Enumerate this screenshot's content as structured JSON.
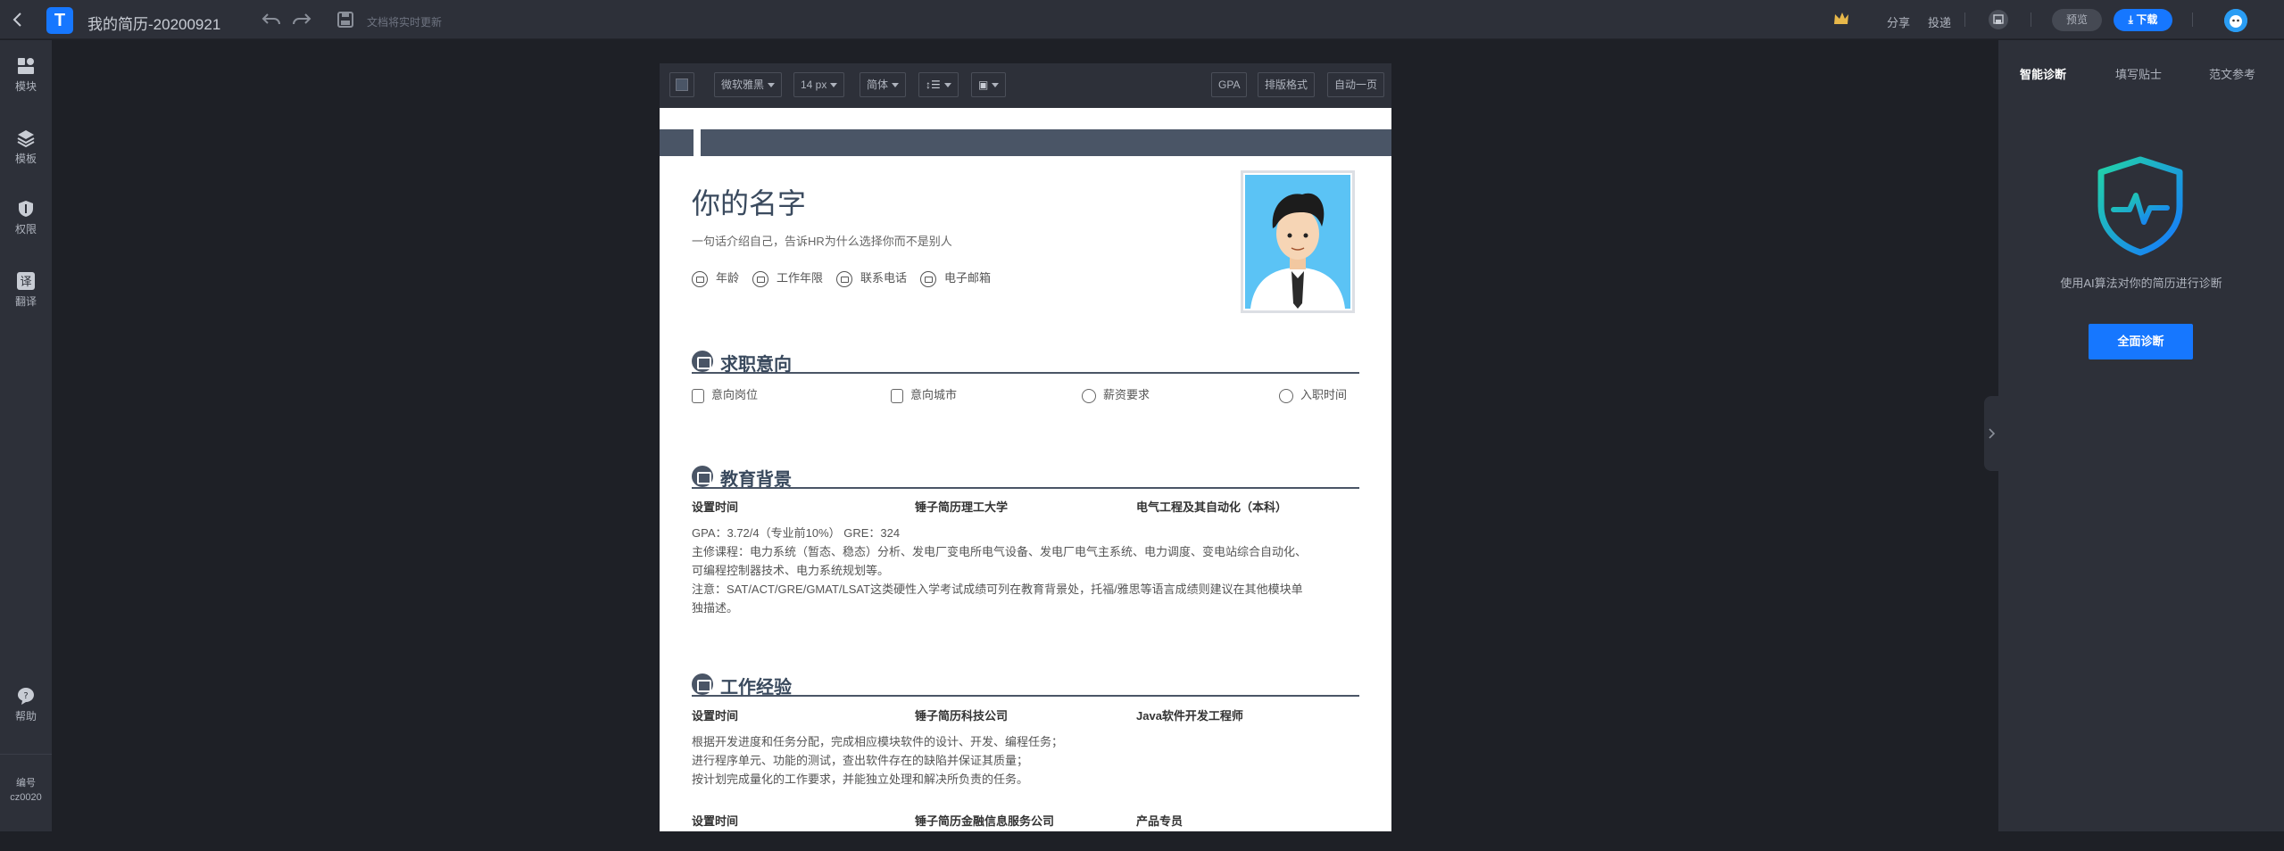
{
  "topbar": {
    "doc_title": "我的简历-20200921",
    "save_status": "文档将实时更新",
    "share": "分享",
    "deliver": "投递",
    "preview": "预览",
    "download": "下载",
    "logo_glyph": "T"
  },
  "leftbar": {
    "items": [
      {
        "label": "模块",
        "icon": "module-icon"
      },
      {
        "label": "模板",
        "icon": "template-icon"
      },
      {
        "label": "权限",
        "icon": "permission-icon"
      },
      {
        "label": "翻译",
        "icon": "translate-icon"
      }
    ],
    "help": "帮助",
    "code_label": "编号",
    "code_value": "cz0020"
  },
  "toolbar": {
    "font": "微软雅黑",
    "size": "14 px",
    "script": "简体",
    "gpa": "GPA",
    "layout": "排版格式",
    "one_page": "自动一页"
  },
  "resume": {
    "name": "你的名字",
    "intro": "一句话介绍自己，告诉HR为什么选择你而不是别人",
    "info": [
      "年龄",
      "工作年限",
      "联系电话",
      "电子邮箱"
    ],
    "intent": {
      "title": "求职意向",
      "items": [
        "意向岗位",
        "意向城市",
        "薪资要求",
        "入职时间"
      ]
    },
    "education": {
      "title": "教育背景",
      "time": "设置时间",
      "school": "锤子简历理工大学",
      "major": "电气工程及其自动化（本科）",
      "lines": [
        "GPA：3.72/4（专业前10%） GRE：324",
        "主修课程：电力系统（暂态、稳态）分析、发电厂变电所电气设备、发电厂电气主系统、电力调度、变电站综合自动化、",
        "可编程控制器技术、电力系统规划等。",
        "注意：SAT/ACT/GRE/GMAT/LSAT这类硬性入学考试成绩可列在教育背景处，托福/雅思等语言成绩则建议在其他模块单",
        "独描述。"
      ]
    },
    "work": {
      "title": "工作经验",
      "jobs": [
        {
          "time": "设置时间",
          "company": "锤子简历科技公司",
          "role": "Java软件开发工程师",
          "lines": [
            "根据开发进度和任务分配，完成相应模块软件的设计、开发、编程任务；",
            "进行程序单元、功能的测试，查出软件存在的缺陷并保证其质量；",
            "按计划完成量化的工作要求，并能独立处理和解决所负责的任务。"
          ]
        },
        {
          "time": "设置时间",
          "company": "锤子简历金融信息服务公司",
          "role": "产品专员",
          "lines": []
        }
      ]
    }
  },
  "rightpanel": {
    "tabs": [
      "智能诊断",
      "填写贴士",
      "范文参考"
    ],
    "desc": "使用AI算法对你的简历进行诊断",
    "button": "全面诊断"
  },
  "colors": {
    "accent": "#1677ff",
    "section_color": "#4a5566",
    "chrome_bg": "#2d3039",
    "workspace_bg": "#1e2026"
  }
}
